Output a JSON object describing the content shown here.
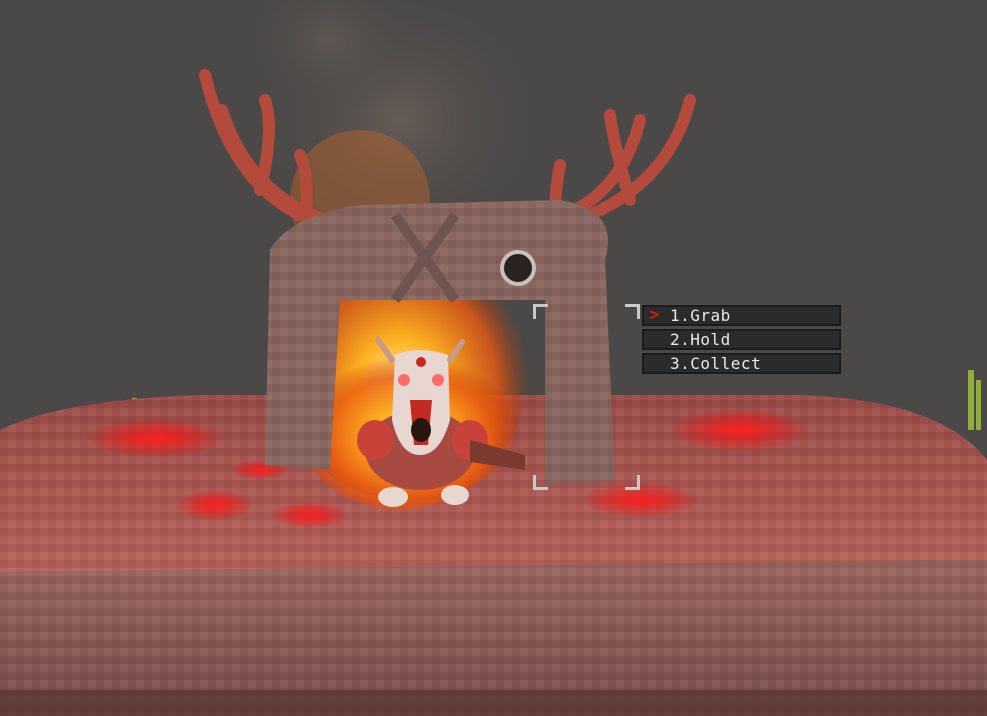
{
  "interaction_menu": {
    "selected_marker": ">",
    "items": [
      {
        "label": "1.Grab",
        "selected": true
      },
      {
        "label": "2.Hold",
        "selected": false
      },
      {
        "label": "3.Collect",
        "selected": false
      }
    ]
  },
  "colors": {
    "sky": "#4b4948",
    "platform_top": "#b35a55",
    "platform_side": "#8e5a55",
    "rune_glow": "#ff1a1a",
    "fire": "#ffb020",
    "menu_bg": "#2b2b2b",
    "menu_text": "#e9e9e9",
    "cursor": "#e01515",
    "bracket": "#c9c9c9"
  }
}
